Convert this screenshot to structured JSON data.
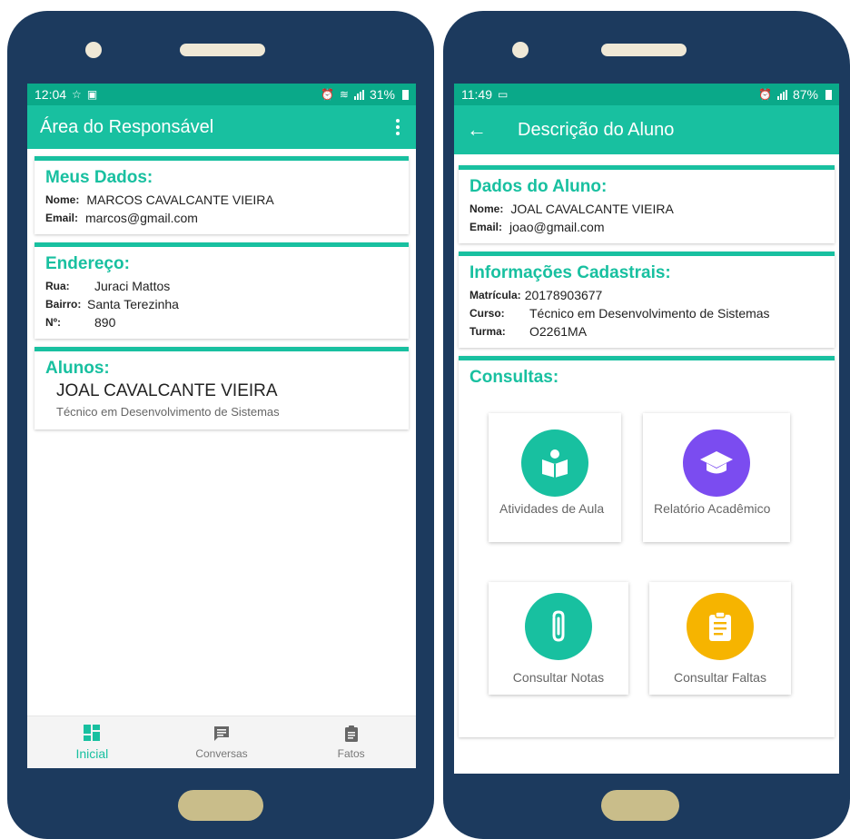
{
  "left_phone": {
    "status": {
      "time": "12:04",
      "battery": "31%"
    },
    "appbar": {
      "title": "Área do Responsável"
    },
    "meus_dados": {
      "title": "Meus Dados:",
      "rows": [
        {
          "key": "Nome:",
          "value": "MARCOS CAVALCANTE VIEIRA"
        },
        {
          "key": "Email:",
          "value": "marcos@gmail.com"
        }
      ]
    },
    "endereco": {
      "title": "Endereço:",
      "rows": [
        {
          "key": "Rua:",
          "value": "Juraci Mattos"
        },
        {
          "key": "Bairro:",
          "value": "Santa Terezinha"
        },
        {
          "key": "Nº:",
          "value": "890"
        }
      ]
    },
    "alunos": {
      "title": "Alunos:",
      "name": "JOAL CAVALCANTE VIEIRA",
      "course": "Técnico em Desenvolvimento de Sistemas"
    },
    "bottom_nav": [
      {
        "label": "Inicial",
        "icon": "dashboard-icon",
        "active": true
      },
      {
        "label": "Conversas",
        "icon": "chat-icon",
        "active": false
      },
      {
        "label": "Fatos",
        "icon": "clipboard-icon",
        "active": false
      }
    ]
  },
  "right_phone": {
    "status": {
      "time": "11:49",
      "battery": "87%"
    },
    "appbar": {
      "back": "←",
      "title": "Descrição do Aluno"
    },
    "dados_aluno": {
      "title": "Dados do Aluno:",
      "rows": [
        {
          "key": "Nome:",
          "value": "JOAL CAVALCANTE VIEIRA"
        },
        {
          "key": "Email:",
          "value": "joao@gmail.com"
        }
      ]
    },
    "informacoes": {
      "title": "Informações Cadastrais:",
      "rows": [
        {
          "key": "Matrícula:",
          "value": "20178903677"
        },
        {
          "key": "Curso:",
          "value": "Técnico em Desenvolvimento de Sistemas"
        },
        {
          "key": "Turma:",
          "value": "O2261MA"
        }
      ]
    },
    "consultas": {
      "title": "Consultas:",
      "tiles": [
        {
          "label": "Atividades de Aula",
          "icon": "book-reader-icon",
          "color": "#18c0a0"
        },
        {
          "label": "Relatório Acadêmico",
          "icon": "graduation-cap-icon",
          "color": "#7b4cf0"
        },
        {
          "label": "Consultar Notas",
          "icon": "paperclip-icon",
          "color": "#18c0a0"
        },
        {
          "label": "Consultar Faltas",
          "icon": "clipboard-list-icon",
          "color": "#f6b400"
        }
      ]
    }
  },
  "colors": {
    "teal": "#18c0a0",
    "status_teal": "#0aa989",
    "frame": "#1c3a5e",
    "purple": "#7b4cf0",
    "amber": "#f6b400"
  }
}
